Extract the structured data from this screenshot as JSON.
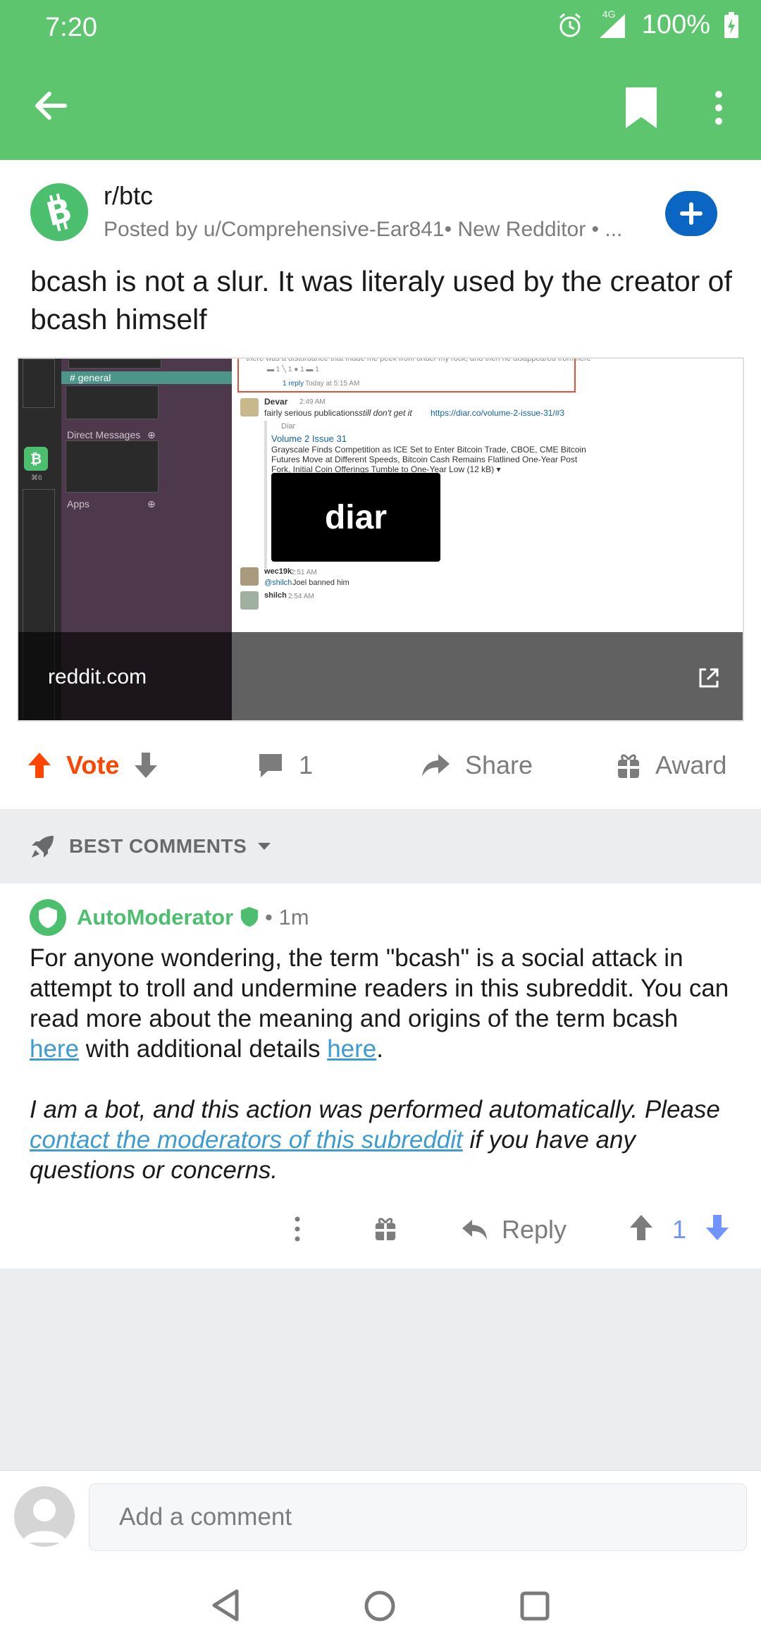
{
  "status_bar": {
    "time": "7:20",
    "network": "4G",
    "battery": "100%"
  },
  "post": {
    "subreddit": "r/btc",
    "meta": "Posted by u/Comprehensive-Ear841• New Redditor • ...",
    "title": "bcash is not a slur. It was literaly used by the creator of bcash himself"
  },
  "preview": {
    "domain": "reddit.com",
    "slack": {
      "channel": "# general",
      "direct_messages": "Direct Messages",
      "apps": "Apps",
      "rail_label": "⌘6",
      "top_line": "there was a disturbance that made me peek from under my rock, and then he disappeared from here",
      "reply_count": "1 reply",
      "reply_time": "Today at 5:15 AM",
      "msg1_author": "Devar",
      "msg1_time": "2:49 AM",
      "msg1_text_a": "fairly serious publications",
      "msg1_text_em": "still don't get it",
      "msg1_link": "https://diar.co/volume-2-issue-31/#3",
      "embed_source": "Diar",
      "embed_title": "Volume 2 Issue 31",
      "embed_line1": "Grayscale Finds Competition as ICE Set to Enter Bitcoin Trade, CBOE, CME Bitcoin",
      "embed_line2": "Futures Move at Different Speeds, Bitcoin Cash Remains Flatlined One-Year Post",
      "embed_line3": "Fork, Initial Coin Offerings Tumble to One-Year Low (12 kB) ▾",
      "embed_logo": "diar",
      "msg2_author": "wec19k",
      "msg2_time": "2:51 AM",
      "msg2_mention": "@shilch",
      "msg2_text": "Joel banned him",
      "msg3_author": "shilch",
      "msg3_time": "2:54 AM"
    }
  },
  "actions": {
    "vote": "Vote",
    "comments": "1",
    "share": "Share",
    "award": "Award"
  },
  "sort": {
    "label": "BEST COMMENTS"
  },
  "comment": {
    "author": "AutoModerator",
    "time": "• 1m",
    "para1_a": "For anyone wondering, the term \"bcash\" is a social attack in attempt to troll and undermine readers in this subreddit. You can read more about the meaning and origins of the term bcash ",
    "link1": "here",
    "para1_b": " with additional details ",
    "link2": "here",
    "para1_c": ".",
    "para2_a": "I am a bot, and this action was performed automatically. Please ",
    "link3": "contact the moderators of this subreddit",
    "para2_b": " if you have any questions or concerns.",
    "reply": "Reply",
    "score": "1"
  },
  "composer": {
    "placeholder": "Add a comment"
  },
  "colors": {
    "brand": "#5cc56d",
    "upvote": "#ff4500",
    "link": "#3d9bd1",
    "downvote_active": "#7193ff"
  }
}
